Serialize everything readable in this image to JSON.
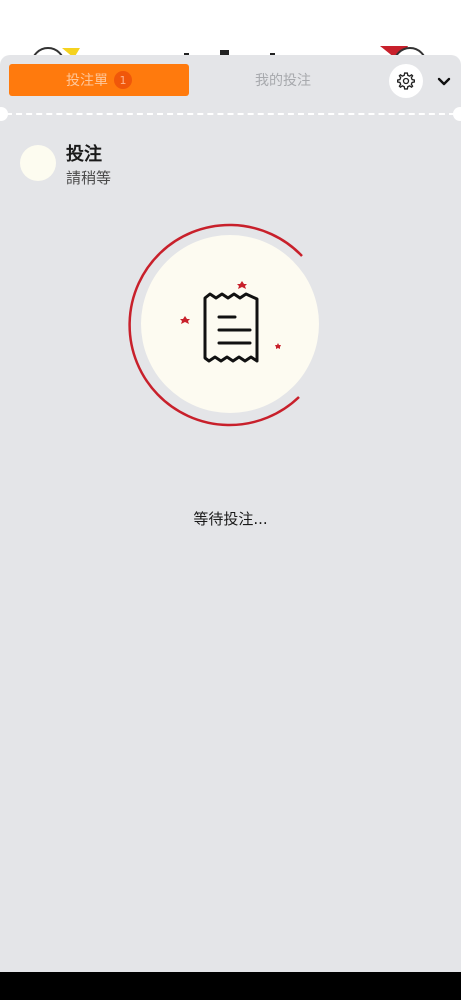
{
  "tabs": {
    "bet_slip_label": "投注單",
    "bet_slip_count": "1",
    "my_bets_label": "我的投注"
  },
  "icons": {
    "settings": "gear-icon",
    "collapse": "chevron-down-icon",
    "receipt": "receipt-icon"
  },
  "bet": {
    "title": "投注",
    "subtitle": "請稍等"
  },
  "status": {
    "waiting": "等待投注..."
  },
  "colors": {
    "accent": "#ff7a0d",
    "sheet_bg": "#e4e5e8",
    "spinner": "#c8202b"
  }
}
